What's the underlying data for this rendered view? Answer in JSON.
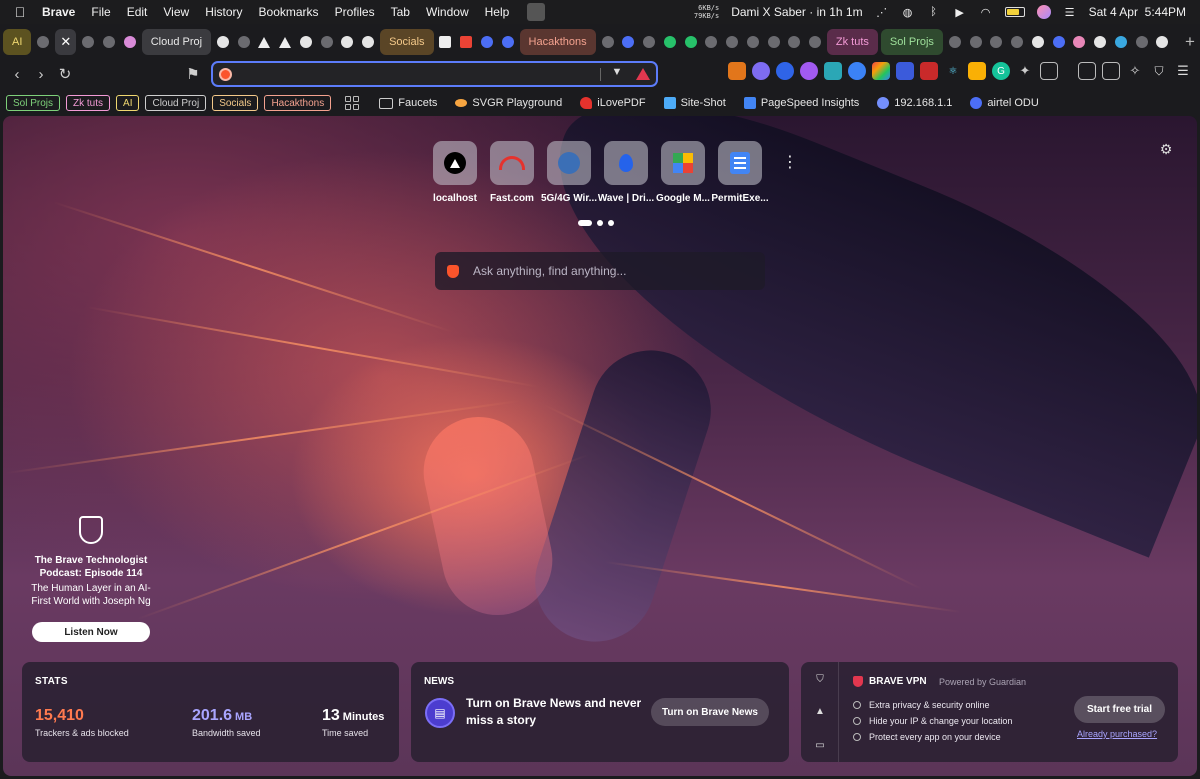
{
  "menubar": {
    "app": "Brave",
    "menus": [
      "File",
      "Edit",
      "View",
      "History",
      "Bookmarks",
      "Profiles",
      "Tab",
      "Window",
      "Help"
    ],
    "net_up": "6KB/s",
    "net_down": "79KB/s",
    "event": "Dami X Saber · in 1h 1m",
    "datetime": "Sat 4 Apr  5:44PM"
  },
  "tabs": {
    "groups": [
      {
        "label": "AI",
        "bg": "#5c5220",
        "fg": "#f0d870"
      },
      {
        "label": "Cloud Proj",
        "bg": "#3b3b3f",
        "fg": "#e8e8e8"
      },
      {
        "label": "Socials",
        "bg": "#5a4526",
        "fg": "#f4c98a"
      },
      {
        "label": "Hacakthons",
        "bg": "#5a3630",
        "fg": "#f4a28f"
      },
      {
        "label": "Zk tuts",
        "bg": "#5a2c4a",
        "fg": "#f39ad6"
      },
      {
        "label": "Sol Projs",
        "bg": "#2f4a2f",
        "fg": "#9fe09b"
      }
    ],
    "active_close": "✕",
    "new_tab": "+"
  },
  "toolbar": {
    "address_value": "",
    "address_placeholder": ""
  },
  "bookmarks": {
    "groups": [
      {
        "label": "Sol Projs",
        "color": "#7ed17a"
      },
      {
        "label": "Zk tuts",
        "color": "#f39ad6"
      },
      {
        "label": "AI",
        "color": "#f0d870"
      },
      {
        "label": "Cloud Proj",
        "color": "#cfcfcf"
      },
      {
        "label": "Socials",
        "color": "#f4c98a"
      },
      {
        "label": "Hacakthons",
        "color": "#f4a28f"
      }
    ],
    "items": [
      {
        "label": "Faucets"
      },
      {
        "label": "SVGR Playground"
      },
      {
        "label": "iLovePDF"
      },
      {
        "label": "Site-Shot"
      },
      {
        "label": "PageSpeed Insights"
      },
      {
        "label": "192.168.1.1"
      },
      {
        "label": "airtel ODU"
      }
    ]
  },
  "top_sites": [
    {
      "label": "localhost",
      "icon": "triangle-icon"
    },
    {
      "label": "Fast.com",
      "icon": "speedometer-icon"
    },
    {
      "label": "5G/4G Wir...",
      "icon": "globe-icon"
    },
    {
      "label": "Wave | Dri...",
      "icon": "drop-icon"
    },
    {
      "label": "Google M...",
      "icon": "maps-icon"
    },
    {
      "label": "PermitExe...",
      "icon": "document-icon"
    }
  ],
  "search": {
    "placeholder": "Ask anything, find anything..."
  },
  "podcast": {
    "title": "The Brave Technologist Podcast: Episode 114",
    "description": "The Human Layer in an AI-First World with Joseph Ng",
    "button": "Listen Now"
  },
  "stats": {
    "heading": "STATS",
    "trackers_value": "15,410",
    "trackers_label": "Trackers & ads blocked",
    "bandwidth_value": "201.6",
    "bandwidth_unit": "MB",
    "bandwidth_label": "Bandwidth saved",
    "time_value": "13",
    "time_unit": "Minutes",
    "time_label": "Time saved",
    "trackers_color": "#ff7a4f",
    "bandwidth_color": "#a9a5ff"
  },
  "news": {
    "heading": "NEWS",
    "message": "Turn on Brave News and never miss a story",
    "button": "Turn on Brave News"
  },
  "vpn": {
    "title": "BRAVE VPN",
    "powered": "Powered by  Guardian",
    "features": [
      "Extra privacy & security online",
      "Hide your IP & change your location",
      "Protect every app on your device"
    ],
    "button": "Start free trial",
    "link": "Already purchased?"
  }
}
